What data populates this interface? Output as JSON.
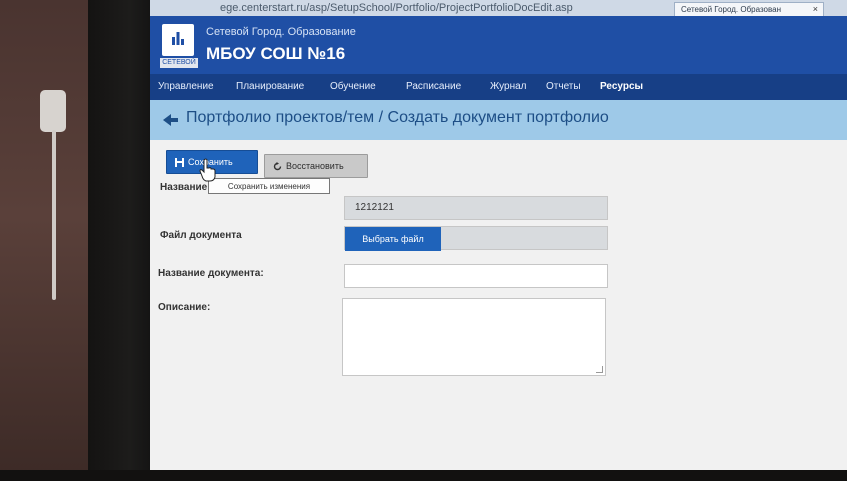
{
  "browser": {
    "url": "ege.centerstart.ru/asp/SetupSchool/Portfolio/ProjectPortfolioDocEdit.asp",
    "tab_title": "Сетевой Город. Образован",
    "tab_close": "×"
  },
  "header": {
    "logo_caption": "СЕТЕВОЙ",
    "org_name": "Сетевой Город. Образование",
    "school_name": "МБОУ СОШ №16"
  },
  "nav": {
    "items": [
      "Управление",
      "Планирование",
      "Обучение",
      "Расписание",
      "Журнал",
      "Отчеты",
      "Ресурсы"
    ]
  },
  "page": {
    "title": "Портфолио проектов/тем / Создать документ портфолио"
  },
  "toolbar": {
    "save_label": "Сохранить",
    "restore_label": "Восстановить",
    "save_tooltip": "Сохранить изменения"
  },
  "form": {
    "name_label": "Название:",
    "name_value": "1212121",
    "file_label": "Файл документа",
    "file_button": "Выбрать файл",
    "doc_name_label": "Название документа:",
    "doc_name_value": "",
    "description_label": "Описание:",
    "description_value": ""
  },
  "colors": {
    "header_blue": "#1f4fa5",
    "nav_blue": "#173f86",
    "title_bar": "#9ec9e8",
    "button_blue": "#1f63ba"
  }
}
